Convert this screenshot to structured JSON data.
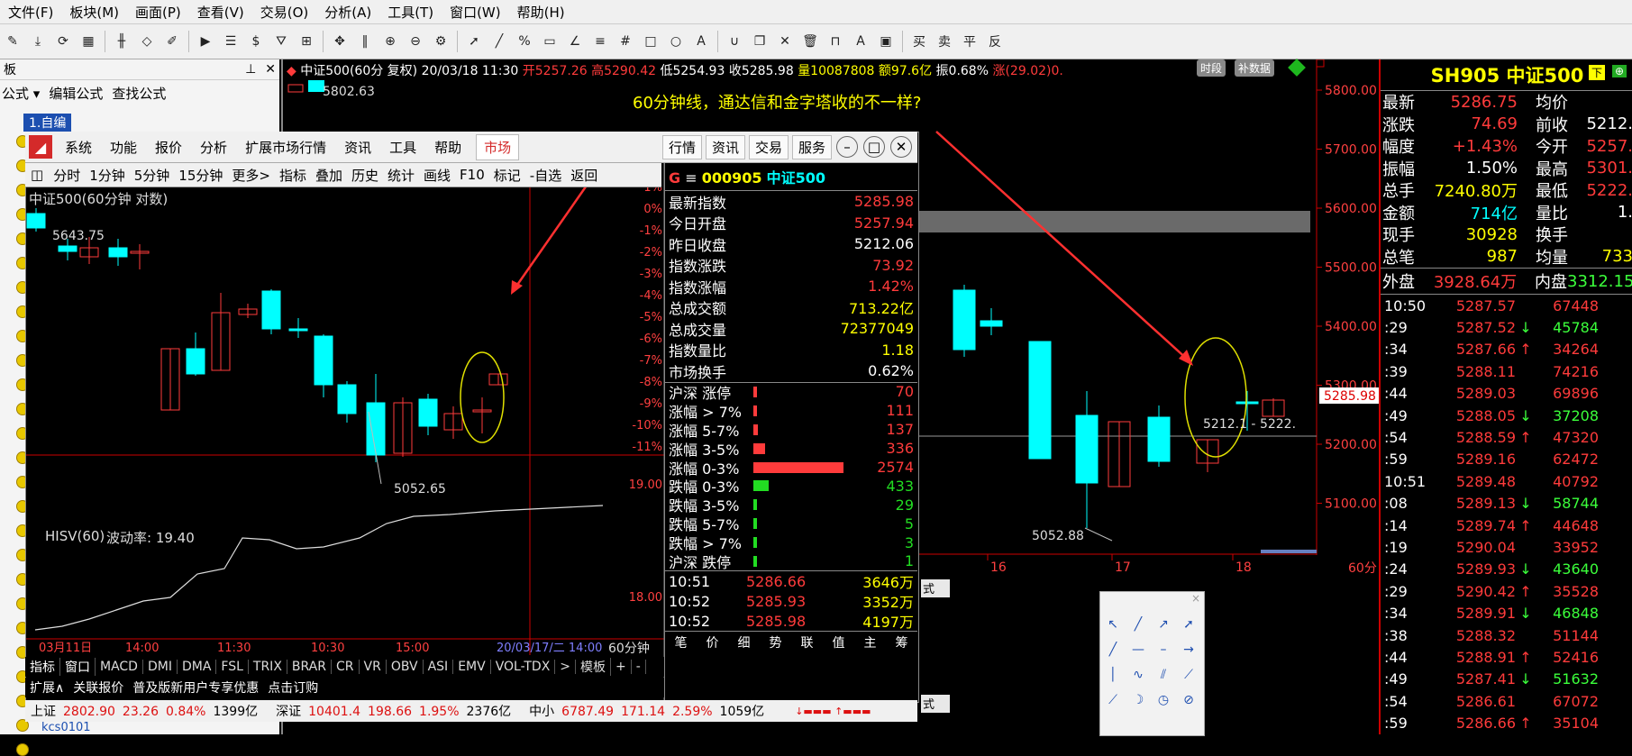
{
  "menubar": [
    "文件(F)",
    "板块(M)",
    "画面(P)",
    "查看(V)",
    "交易(O)",
    "分析(A)",
    "工具(T)",
    "窗口(W)",
    "帮助(H)"
  ],
  "left_panel": {
    "header": "板",
    "links": [
      "公式 ▾",
      "编辑公式",
      "查找公式"
    ],
    "selected_item": "1.自编",
    "bottom_item": "kcs0101"
  },
  "main_chart": {
    "symbol": "中证500(60分 复权)",
    "date": "20/03/18 11:30",
    "open": "开5257.26",
    "high": "高5290.42",
    "low": "低5254.93",
    "close": "收5285.98",
    "volume": "量10087808",
    "amount": "额97.6亿",
    "amplitude": "振0.68%",
    "change": "涨(29.02)0.",
    "btn_timeseg": "时段",
    "btn_data": "补数据",
    "legend_value": "5802.63",
    "annotation": "60分钟线，通达信和金字塔收的不一样?",
    "price_axis": [
      "5800.00",
      "5700.00",
      "5600.00",
      "5500.00",
      "5400.00",
      "5300.00",
      "5200.00",
      "5100.00"
    ],
    "current_price_tag": "5285.98",
    "low_label": "5052.88",
    "range_label": "5212.1 - 5222.",
    "date_axis": [
      "16",
      "17",
      "18"
    ],
    "period": "60分"
  },
  "window": {
    "menu": [
      "系统",
      "功能",
      "报价",
      "分析",
      "扩展市场行情",
      "资讯",
      "工具",
      "帮助"
    ],
    "market_tab": "市场",
    "right_tabs": [
      "行情",
      "资讯",
      "交易",
      "服务"
    ],
    "nav": [
      "分时",
      "1分钟",
      "5分钟",
      "15分钟",
      "更多>",
      "指标",
      "叠加",
      "历史",
      "统计",
      "画线",
      "F10",
      "标记",
      "-自选",
      "返回"
    ],
    "chart_title": "中证500(60分钟 对数)",
    "high_label": "5643.75",
    "low_label": "5052.65",
    "pct_axis": [
      "1%",
      "0%",
      "-1%",
      "-2%",
      "-3%",
      "-4%",
      "-5%",
      "-6%",
      "-7%",
      "-8%",
      "-9%",
      "-10%",
      "-11%"
    ],
    "indicator_label": "HISV(60)",
    "indicator_value": "波动率: 19.40",
    "ind_axis": [
      "19.00",
      "18.00"
    ],
    "x_axis": [
      "03月11日",
      "14:00",
      "11:30",
      "10:30",
      "15:00",
      "20/03/17/二 14:00"
    ],
    "period_btn": "60分钟",
    "ind_tabs": [
      "指标",
      "窗口",
      "MACD",
      "DMI",
      "DMA",
      "FSL",
      "TRIX",
      "BRAR",
      "CR",
      "VR",
      "OBV",
      "ASI",
      "EMV",
      "VOL-TDX",
      ">",
      "模板",
      "+",
      "-"
    ],
    "ext_tabs": [
      "扩展∧",
      "关联报价",
      "普及版新用户专享优惠",
      "点击订购"
    ],
    "status": [
      {
        "name": "上证",
        "price": "2802.90",
        "chg": "23.26",
        "pct": "0.84%",
        "amt": "1399亿"
      },
      {
        "name": "深证",
        "price": "10401.4",
        "chg": "198.66",
        "pct": "1.95%",
        "amt": "2376亿"
      },
      {
        "name": "中小",
        "price": "6787.49",
        "chg": "171.14",
        "pct": "2.59%",
        "amt": "1059亿"
      }
    ]
  },
  "quote": {
    "code": "000905",
    "name": "中证500",
    "rows": [
      {
        "label": "最新指数",
        "value": "5285.98",
        "color": "#ff3b3b"
      },
      {
        "label": "今日开盘",
        "value": "5257.94",
        "color": "#ff3b3b"
      },
      {
        "label": "昨日收盘",
        "value": "5212.06",
        "color": "#ffffff"
      },
      {
        "label": "指数涨跌",
        "value": "73.92",
        "color": "#ff3b3b"
      },
      {
        "label": "指数涨幅",
        "value": "1.42%",
        "color": "#ff3b3b"
      },
      {
        "label": "总成交额",
        "value": "713.22亿",
        "color": "#ffff00"
      },
      {
        "label": "总成交量",
        "value": "72377049",
        "color": "#ffff00"
      },
      {
        "label": "指数量比",
        "value": "1.18",
        "color": "#ffff00"
      },
      {
        "label": "市场换手",
        "value": "0.62%",
        "color": "#ffffff"
      }
    ],
    "breadth": [
      {
        "label": "沪深 涨停",
        "value": "70",
        "bar": 0.02,
        "color": "#ff3b3b"
      },
      {
        "label": "涨幅 > 7%",
        "value": "111",
        "bar": 0.04,
        "color": "#ff3b3b"
      },
      {
        "label": "涨幅 5-7%",
        "value": "137",
        "bar": 0.05,
        "color": "#ff3b3b"
      },
      {
        "label": "涨幅 3-5%",
        "value": "336",
        "bar": 0.13,
        "color": "#ff3b3b"
      },
      {
        "label": "涨幅 0-3%",
        "value": "2574",
        "bar": 1.0,
        "color": "#ff3b3b"
      },
      {
        "label": "跌幅 0-3%",
        "value": "433",
        "bar": 0.17,
        "color": "#22dd22"
      },
      {
        "label": "跌幅 3-5%",
        "value": "29",
        "bar": 0.01,
        "color": "#22dd22"
      },
      {
        "label": "跌幅 5-7%",
        "value": "5",
        "bar": 0.005,
        "color": "#22dd22"
      },
      {
        "label": "跌幅 > 7%",
        "value": "3",
        "bar": 0.005,
        "color": "#22dd22"
      },
      {
        "label": "沪深 跌停",
        "value": "1",
        "bar": 0.005,
        "color": "#22dd22"
      }
    ],
    "ticks": [
      {
        "time": "10:51",
        "price": "5286.66",
        "vol": "3646万"
      },
      {
        "time": "10:52",
        "price": "5285.93",
        "vol": "3352万"
      },
      {
        "time": "10:52",
        "price": "5285.98",
        "vol": "4197万"
      }
    ],
    "bottom_tabs": [
      "笔",
      "价",
      "细",
      "势",
      "联",
      "值",
      "主",
      "筹"
    ]
  },
  "right_panel": {
    "title": "SH905 中证500",
    "stats": [
      {
        "l1": "最新",
        "v1": "5286.75",
        "c1": "#ff3b3b",
        "l2": "均价",
        "v2": "",
        "c2": "#fff"
      },
      {
        "l1": "涨跌",
        "v1": "74.69",
        "c1": "#ff3b3b",
        "l2": "前收",
        "v2": "5212.",
        "c2": "#fff"
      },
      {
        "l1": "幅度",
        "v1": "+1.43%",
        "c1": "#ff3b3b",
        "l2": "今开",
        "v2": "5257.",
        "c2": "#ff3b3b"
      },
      {
        "l1": "振幅",
        "v1": "1.50%",
        "c1": "#fff",
        "l2": "最高",
        "v2": "5301.",
        "c2": "#ff3b3b"
      },
      {
        "l1": "总手",
        "v1": "7240.80万",
        "c1": "#ffff00",
        "l2": "最低",
        "v2": "5222.",
        "c2": "#ff3b3b"
      },
      {
        "l1": "金额",
        "v1": "714亿",
        "c1": "#00ffff",
        "l2": "量比",
        "v2": "1.",
        "c2": "#fff"
      },
      {
        "l1": "现手",
        "v1": "30928",
        "c1": "#ffff00",
        "l2": "换手",
        "v2": "",
        "c2": "#fff"
      },
      {
        "l1": "总笔",
        "v1": "987",
        "c1": "#ffff00",
        "l2": "均量",
        "v2": "733",
        "c2": "#ffff00"
      }
    ],
    "outer": "外盘",
    "outer_v": "3928.64万",
    "inner": "内盘",
    "inner_v": "3312.15",
    "ticks": [
      {
        "t": "10:50",
        "p": "5287.57",
        "a": "",
        "v": "67448"
      },
      {
        "t": ":29",
        "p": "5287.52",
        "a": "↓",
        "v": "45784"
      },
      {
        "t": ":34",
        "p": "5287.66",
        "a": "↑",
        "v": "34264"
      },
      {
        "t": ":39",
        "p": "5288.11",
        "a": "",
        "v": "74216"
      },
      {
        "t": ":44",
        "p": "5289.03",
        "a": "",
        "v": "69896"
      },
      {
        "t": ":49",
        "p": "5288.05",
        "a": "↓",
        "v": "37208"
      },
      {
        "t": ":54",
        "p": "5288.59",
        "a": "↑",
        "v": "47320"
      },
      {
        "t": ":59",
        "p": "5289.16",
        "a": "",
        "v": "62472"
      },
      {
        "t": "10:51",
        "p": "5289.48",
        "a": "",
        "v": "40792"
      },
      {
        "t": ":08",
        "p": "5289.13",
        "a": "↓",
        "v": "58744"
      },
      {
        "t": ":14",
        "p": "5289.74",
        "a": "↑",
        "v": "44648"
      },
      {
        "t": ":19",
        "p": "5290.04",
        "a": "",
        "v": "33952"
      },
      {
        "t": ":24",
        "p": "5289.93",
        "a": "↓",
        "v": "43640"
      },
      {
        "t": ":29",
        "p": "5290.42",
        "a": "↑",
        "v": "35528"
      },
      {
        "t": ":34",
        "p": "5289.91",
        "a": "↓",
        "v": "46848"
      },
      {
        "t": ":38",
        "p": "5288.32",
        "a": "",
        "v": "51144"
      },
      {
        "t": ":44",
        "p": "5288.91",
        "a": "↑",
        "v": "52416"
      },
      {
        "t": ":49",
        "p": "5287.41",
        "a": "↓",
        "v": "51632"
      },
      {
        "t": ":54",
        "p": "5286.61",
        "a": "",
        "v": "67072"
      },
      {
        "t": ":59",
        "p": "5286.66",
        "a": "↑",
        "v": "35104"
      }
    ]
  },
  "misc": {
    "style_btn_1": "式(N)",
    "style_btn_2": "式(N)"
  }
}
